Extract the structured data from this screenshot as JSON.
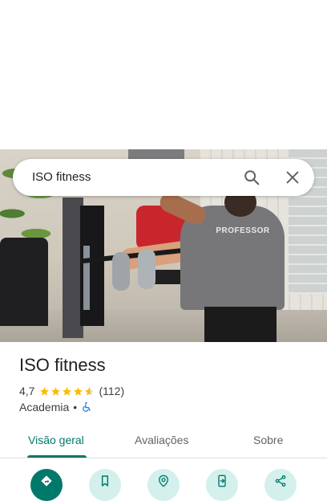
{
  "search": {
    "query": "ISO fitness"
  },
  "hero": {
    "shirt_text": "PROFESSOR"
  },
  "place": {
    "name": "ISO fitness",
    "rating": "4,7",
    "stars": 4.7,
    "review_count": "(112)",
    "category": "Academia",
    "separator": "•"
  },
  "tabs": [
    {
      "label": "Visão geral",
      "active": true
    },
    {
      "label": "Avaliações",
      "active": false
    },
    {
      "label": "Sobre",
      "active": false
    }
  ],
  "actions": [
    {
      "icon": "directions-icon"
    },
    {
      "icon": "bookmark-icon"
    },
    {
      "icon": "nearby-icon"
    },
    {
      "icon": "send-to-phone-icon"
    },
    {
      "icon": "share-icon"
    }
  ],
  "colors": {
    "accent": "#00796b",
    "accent_light": "#d3f0ec",
    "star": "#fbbc04",
    "accessibility": "#1a73e8"
  }
}
